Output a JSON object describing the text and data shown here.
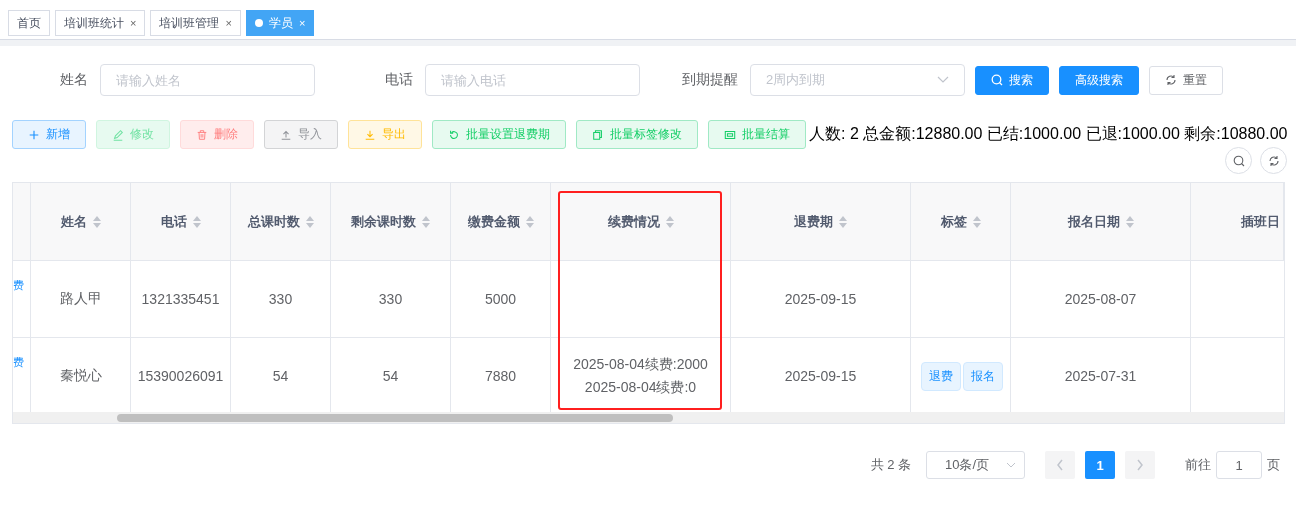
{
  "tabs": [
    {
      "label": "首页",
      "closable": false,
      "selected": false
    },
    {
      "label": "培训班统计",
      "closable": true,
      "selected": false
    },
    {
      "label": "培训班管理",
      "closable": true,
      "selected": false
    },
    {
      "label": "学员",
      "closable": true,
      "selected": true
    }
  ],
  "close_glyph": "×",
  "search_form": {
    "fields": [
      {
        "label": "姓名",
        "placeholder": "请输入姓名",
        "kind": "input"
      },
      {
        "label": "电话",
        "placeholder": "请输入电话",
        "kind": "input"
      },
      {
        "label": "到期提醒",
        "placeholder": "2周内到期",
        "kind": "select"
      }
    ],
    "buttons": [
      {
        "label": "搜索",
        "kind": "primary"
      },
      {
        "label": "高级搜索",
        "kind": "primary"
      },
      {
        "label": "重置",
        "kind": "default"
      }
    ]
  },
  "toolbar": {
    "buttons": [
      {
        "label": "新增",
        "kind": "primary"
      },
      {
        "label": "修改",
        "kind": "success"
      },
      {
        "label": "删除",
        "kind": "danger"
      },
      {
        "label": "导入",
        "kind": "info"
      },
      {
        "label": "导出",
        "kind": "warning"
      },
      {
        "label": "批量设置退费期",
        "kind": "success"
      },
      {
        "label": "批量标签修改",
        "kind": "success"
      },
      {
        "label": "批量结算",
        "kind": "success"
      }
    ],
    "summary": "人数: 2 总金额:12880.00 已结:1000.00 已退:1000.00 剩余:10880.00"
  },
  "table": {
    "columns": [
      {
        "label": "姓名",
        "sortable": true,
        "highlighted": false
      },
      {
        "label": "电话",
        "sortable": true,
        "highlighted": false
      },
      {
        "label": "总课时数",
        "sortable": true,
        "highlighted": false
      },
      {
        "label": "剩余课时数",
        "sortable": true,
        "highlighted": false
      },
      {
        "label": "缴费金额",
        "sortable": true,
        "highlighted": false
      },
      {
        "label": "续费情况",
        "sortable": true,
        "highlighted": true
      },
      {
        "label": "退费期",
        "sortable": true,
        "highlighted": false
      },
      {
        "label": "标签",
        "sortable": true,
        "highlighted": false
      },
      {
        "label": "报名日期",
        "sortable": true,
        "highlighted": false
      },
      {
        "label": "插班日",
        "sortable": false,
        "highlighted": false
      }
    ],
    "rows": [
      {
        "column_1": "费",
        "cells": [
          "路人甲",
          "1321335451",
          "330",
          "330",
          "5000"
        ],
        "renewals": [],
        "refund_period": "2025-09-15",
        "tags": [],
        "signup_date": "2025-08-07"
      },
      {
        "column_1": "费",
        "cells": [
          "秦悦心",
          "15390026091",
          "54",
          "54",
          "7880"
        ],
        "renewals": [
          "2025-08-04续费:2000",
          "2025-08-04续费:0"
        ],
        "refund_period": "2025-09-15",
        "tags": [
          "退费",
          "报名"
        ],
        "signup_date": "2025-07-31"
      }
    ]
  },
  "pagination": {
    "total": "共 2 条",
    "page_size": "10条/页",
    "pages": [
      {
        "label": "1",
        "selected": true
      }
    ],
    "goto_label": "前往",
    "goto_value": "1",
    "page_suffix": "页"
  }
}
